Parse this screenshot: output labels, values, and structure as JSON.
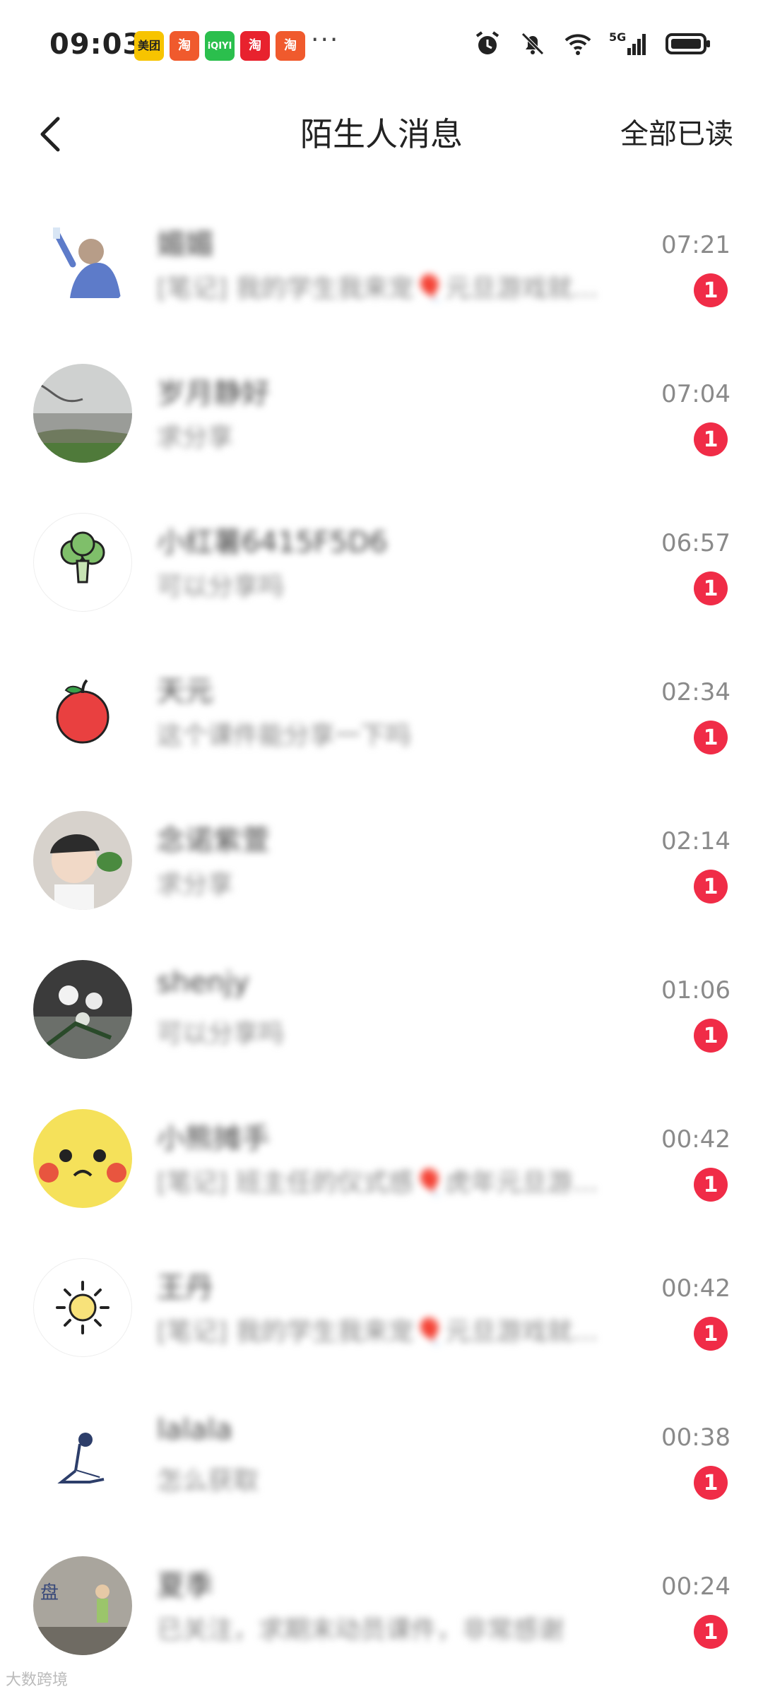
{
  "status_bar": {
    "time": "09:03",
    "app_icons": [
      {
        "name": "meituan-icon",
        "label": "美团",
        "color": "#f7c400"
      },
      {
        "name": "taobao-icon",
        "label": "淘",
        "color": "#f05a2d"
      },
      {
        "name": "iqiyi-icon",
        "label": "iQIYI",
        "color": "#2bbf4d"
      },
      {
        "name": "taobao-icon",
        "label": "淘",
        "color": "#e8222e"
      },
      {
        "name": "taobao-icon",
        "label": "淘",
        "color": "#f05a2d"
      }
    ],
    "more": "···",
    "network": "5G"
  },
  "header": {
    "title": "陌生人消息",
    "read_all": "全部已读"
  },
  "messages": [
    {
      "name": "媚媚",
      "preview": "[笔记] 我的学生我来宠🎈元旦游戏就…",
      "time": "07:21",
      "unread": "1"
    },
    {
      "name": "岁月静好",
      "preview": "求分享",
      "time": "07:04",
      "unread": "1"
    },
    {
      "name": "小红薯6415F5D6",
      "preview": "可以分享吗",
      "time": "06:57",
      "unread": "1"
    },
    {
      "name": "天元",
      "preview": "这个课件能分享一下吗",
      "time": "02:34",
      "unread": "1"
    },
    {
      "name": "念诺紫萱",
      "preview": "求分享",
      "time": "02:14",
      "unread": "1"
    },
    {
      "name": "shenjy",
      "preview": "可以分享吗",
      "time": "01:06",
      "unread": "1"
    },
    {
      "name": "小熊摊手",
      "preview": "[笔记] 班主任的仪式感🎈虎年元旦游…",
      "time": "00:42",
      "unread": "1"
    },
    {
      "name": "王丹",
      "preview": "[笔记] 我的学生我来宠🎈元旦游戏就…",
      "time": "00:42",
      "unread": "1"
    },
    {
      "name": "lalala",
      "preview": "怎么获取",
      "time": "00:38",
      "unread": "1"
    },
    {
      "name": "夏季",
      "preview": "已关注，求期末动员课件，非常感谢",
      "time": "00:24",
      "unread": "1"
    }
  ],
  "watermark": "大数跨境",
  "colors": {
    "badge": "#f02c47",
    "text_primary": "#222222",
    "text_time": "#8a8a8a"
  }
}
